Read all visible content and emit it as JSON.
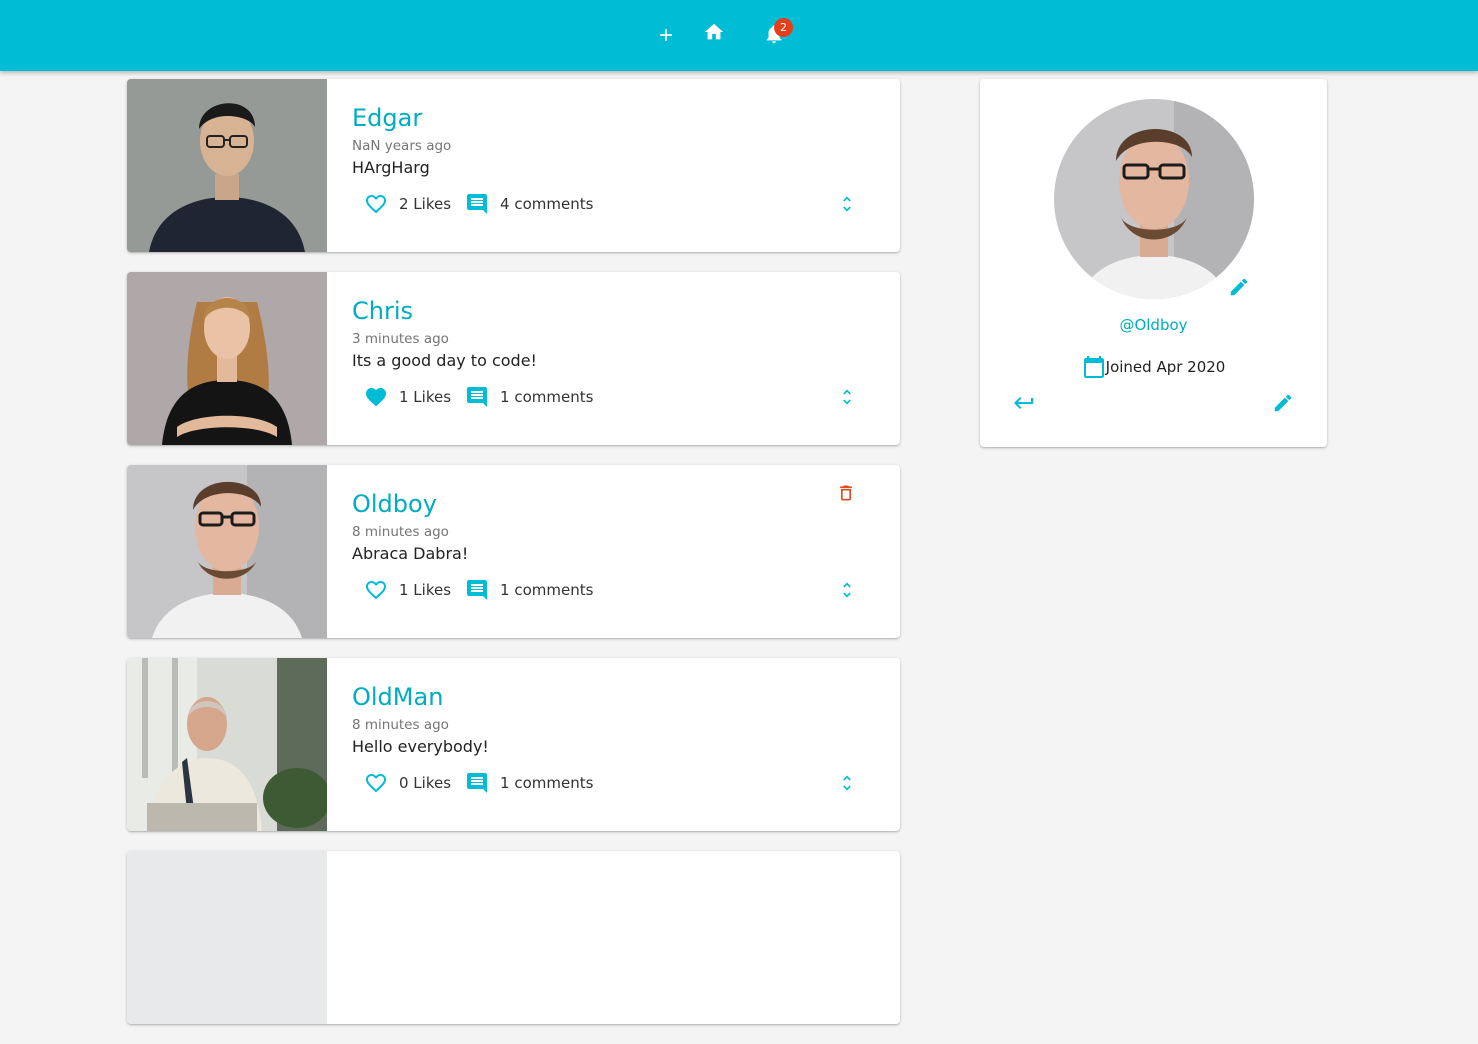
{
  "colors": {
    "primary": "#00bcd4",
    "accent_text": "#00acc1",
    "badge": "#e53e1a",
    "delete": "#e64a19",
    "background": "#f4f4f4"
  },
  "appbar": {
    "actions": [
      {
        "name": "add-icon"
      },
      {
        "name": "home-icon"
      },
      {
        "name": "notifications-icon"
      }
    ],
    "notification_count": "2"
  },
  "posts": [
    {
      "author": "Edgar",
      "time": "NaN years ago",
      "body": "HArgHarg",
      "likes_label": "2 Likes",
      "comments_label": "4 comments",
      "liked": false,
      "deletable": false
    },
    {
      "author": "Chris",
      "time": "3 minutes ago",
      "body": "Its a good day to code!",
      "likes_label": "1 Likes",
      "comments_label": "1 comments",
      "liked": true,
      "deletable": false
    },
    {
      "author": "Oldboy",
      "time": "8 minutes ago",
      "body": "Abraca Dabra!",
      "likes_label": "1 Likes",
      "comments_label": "1 comments",
      "liked": false,
      "deletable": true
    },
    {
      "author": "OldMan",
      "time": "8 minutes ago",
      "body": "Hello everybody!",
      "likes_label": "0 Likes",
      "comments_label": "1 comments",
      "liked": false,
      "deletable": false
    }
  ],
  "profile": {
    "handle": "@Oldboy",
    "joined": "Joined Apr 2020"
  }
}
